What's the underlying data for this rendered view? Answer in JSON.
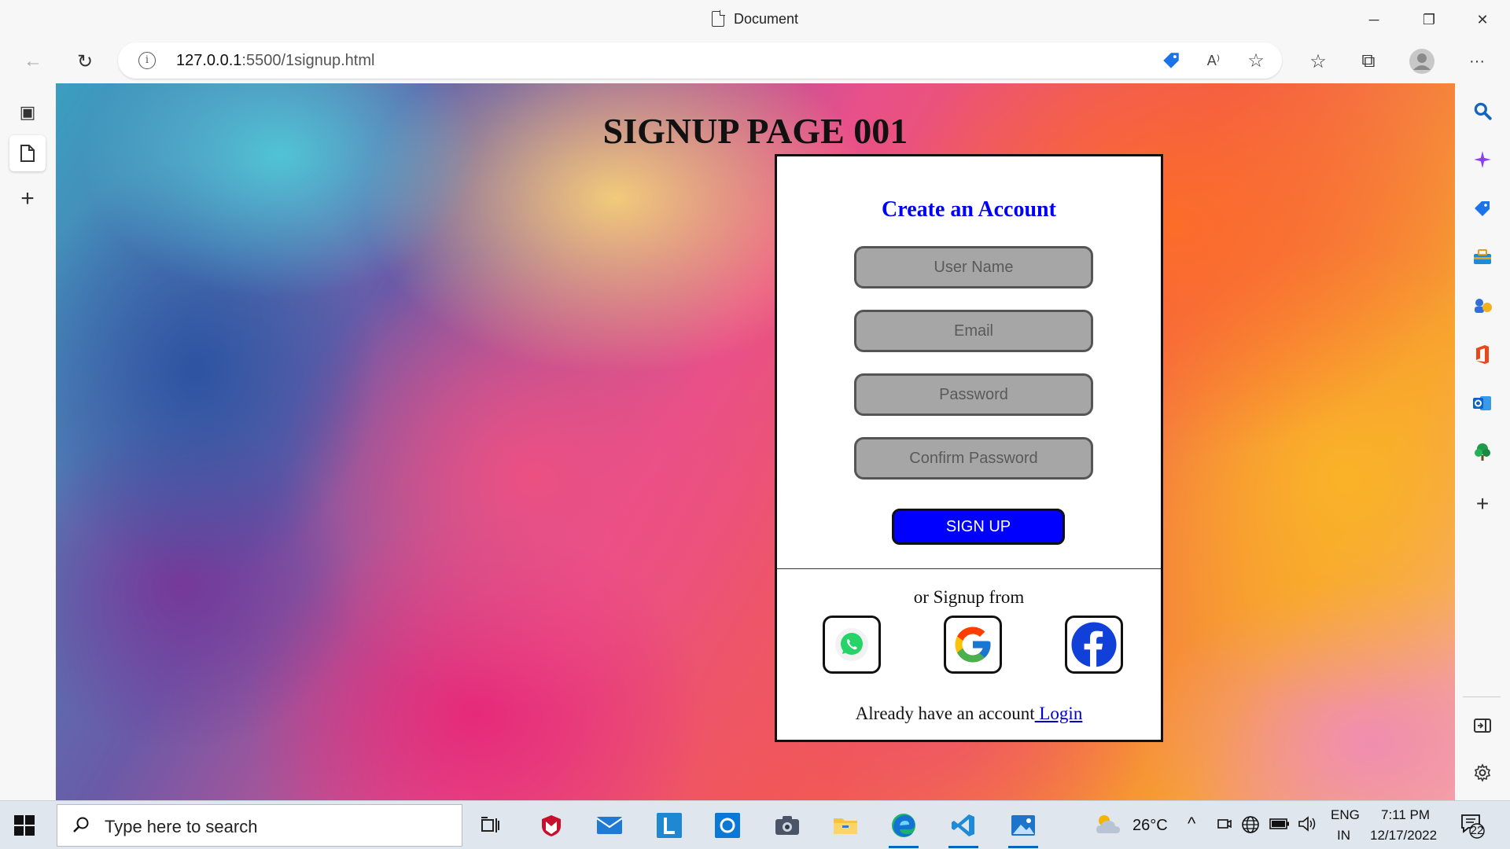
{
  "window": {
    "title": "Document",
    "controls": {
      "minimize": "─",
      "restore": "❐",
      "close": "✕"
    }
  },
  "navbar": {
    "back": "←",
    "refresh": "↻",
    "info": "i",
    "url_host": "127.0.0.1",
    "url_path": ":5500/1signup.html",
    "read_aloud": "A⁾",
    "add_favorite": "☆",
    "favorites": "☆",
    "collections": "⧉",
    "menu": "···"
  },
  "left_tabs": {
    "tab_actions": "▣",
    "current_tab": "▢",
    "new_tab": "+"
  },
  "right_sidebar": {
    "icons": [
      "search-icon",
      "copilot-icon",
      "shopping-icon",
      "tools-icon",
      "games-icon",
      "office-icon",
      "outlook-icon",
      "tree-icon"
    ],
    "add": "+"
  },
  "page": {
    "title": "SIGNUP PAGE 001",
    "card_heading": "Create an Account",
    "fields": {
      "username_placeholder": "User Name",
      "email_placeholder": "Email",
      "password_placeholder": "Password",
      "confirm_placeholder": "Confirm Password"
    },
    "signup_label": "SIGN UP",
    "or_text": "or Signup from",
    "social": [
      "whatsapp",
      "google",
      "facebook"
    ],
    "login_prompt": "Already have an account",
    "login_link": " Login",
    "accent_color": "#0000ff"
  },
  "taskbar": {
    "search_placeholder": "Type here to search",
    "weather_temp": "26°C",
    "language_top": "ENG",
    "language_bottom": "IN",
    "time": "7:11 PM",
    "date": "12/17/2022",
    "notifications": "22"
  }
}
